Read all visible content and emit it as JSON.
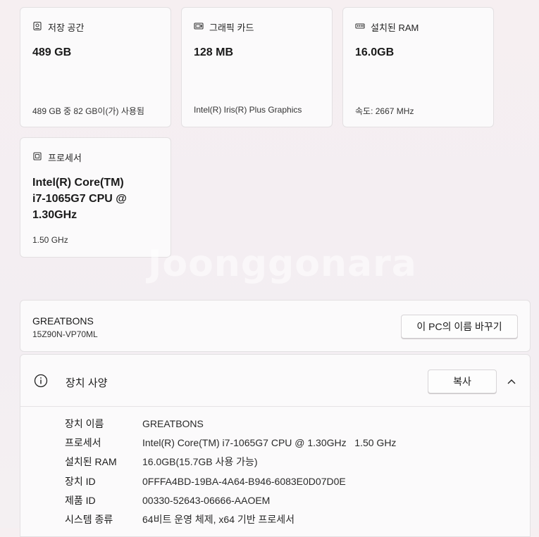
{
  "cards": [
    {
      "title": "저장 공간",
      "value": "489 GB",
      "sub": "489 GB 중 82 GB이(가) 사용됨",
      "icon": "storage-icon"
    },
    {
      "title": "그래픽 카드",
      "value": "128 MB",
      "sub": "Intel(R) Iris(R) Plus Graphics",
      "icon": "graphics-card-icon"
    },
    {
      "title": "설치된 RAM",
      "value": "16.0GB",
      "sub": "속도: 2667 MHz",
      "icon": "ram-icon"
    },
    {
      "title": "프로세서",
      "value_lines": [
        "Intel(R) Core(TM)",
        "i7-1065G7 CPU @",
        "1.30GHz"
      ],
      "sub": "1.50 GHz",
      "icon": "processor-icon"
    }
  ],
  "watermark": "Joonggonara",
  "pc": {
    "name": "GREATBONS",
    "model": "15Z90N-VP70ML",
    "rename_button": "이 PC의 이름 바꾸기"
  },
  "device_specs": {
    "title": "장치 사양",
    "copy_button": "복사",
    "rows": [
      {
        "label": "장치 이름",
        "value": "GREATBONS"
      },
      {
        "label": "프로세서",
        "value": "Intel(R) Core(TM) i7-1065G7 CPU @ 1.30GHz   1.50 GHz"
      },
      {
        "label": "설치된 RAM",
        "value": "16.0GB(15.7GB 사용 가능)"
      },
      {
        "label": "장치 ID",
        "value": "0FFFA4BD-19BA-4A64-B946-6083E0D07D0E"
      },
      {
        "label": "제품 ID",
        "value": "00330-52643-06666-AAOEM"
      },
      {
        "label": "시스템 종류",
        "value": "64비트 운영 체제, x64 기반 프로세서"
      }
    ]
  }
}
